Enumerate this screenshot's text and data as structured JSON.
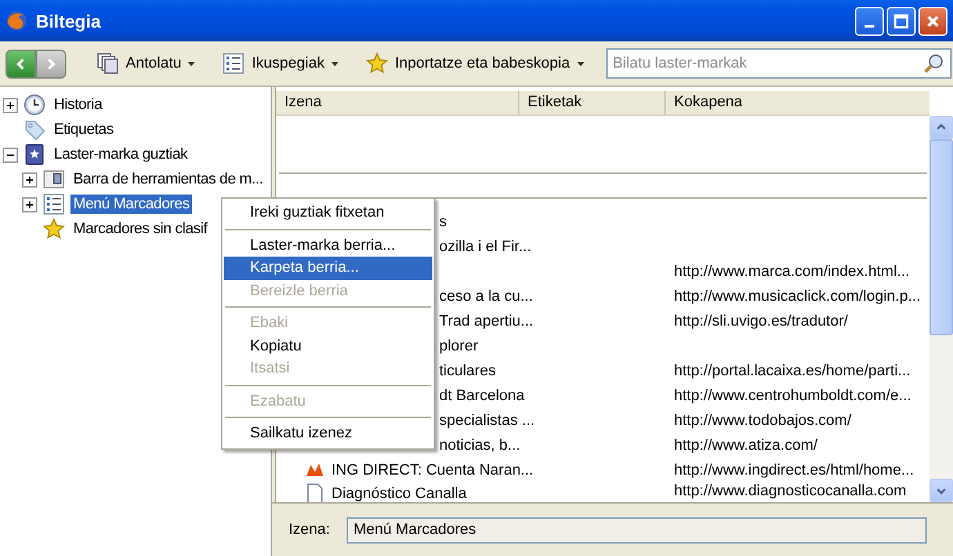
{
  "window": {
    "title": "Biltegia"
  },
  "toolbar": {
    "menus": [
      {
        "label": "Antolatu"
      },
      {
        "label": "Ikuspegiak"
      },
      {
        "label": "Inportatze eta babeskopia"
      }
    ],
    "search": {
      "placeholder": "Bilatu laster-markak"
    }
  },
  "tree": [
    {
      "label": "Historia",
      "kind": "expandable",
      "expanded": false,
      "selected": false
    },
    {
      "label": "Etiquetas",
      "kind": "plain",
      "selected": false
    },
    {
      "label": "Laster-marka guztiak",
      "kind": "expandable",
      "expanded": true,
      "selected": false,
      "children": [
        {
          "label": "Barra de herramientas de m...",
          "kind": "expandable",
          "expanded": false,
          "selected": false
        },
        {
          "label": "Menú Marcadores",
          "kind": "expandable",
          "expanded": false,
          "selected": true
        },
        {
          "label": "Marcadores sin clasif",
          "kind": "plain",
          "selected": false
        }
      ]
    }
  ],
  "table": {
    "columns": [
      "Izena",
      "Etiketak",
      "Kokapena"
    ],
    "rows": [
      {
        "kind": "blank"
      },
      {
        "kind": "blank"
      },
      {
        "kind": "separator"
      },
      {
        "kind": "separator"
      },
      {
        "kind": "bookmark",
        "name": "s",
        "covered": true
      },
      {
        "kind": "bookmark",
        "name": "ozilla i el Fir...",
        "covered": true
      },
      {
        "kind": "bookmark",
        "location": "http://www.marca.com/index.html..."
      },
      {
        "kind": "bookmark",
        "name": "ceso a la cu...",
        "covered": true,
        "location": "http://www.musicaclick.com/login.p..."
      },
      {
        "kind": "bookmark",
        "name": "Trad apertiu...",
        "covered": true,
        "location": "http://sli.uvigo.es/tradutor/"
      },
      {
        "kind": "bookmark",
        "name": "plorer",
        "covered": true
      },
      {
        "kind": "bookmark",
        "name": "ticulares",
        "covered": true,
        "location": "http://portal.lacaixa.es/home/parti..."
      },
      {
        "kind": "bookmark",
        "name": "dt Barcelona",
        "covered": true,
        "location": "http://www.centrohumboldt.com/e..."
      },
      {
        "kind": "bookmark",
        "name": "specialistas ...",
        "covered": true,
        "location": "http://www.todobajos.com/"
      },
      {
        "kind": "bookmark",
        "name": "noticias, b...",
        "covered": true,
        "location": "http://www.atiza.com/"
      },
      {
        "kind": "bookmark",
        "name": "ING DIRECT: Cuenta Naran...",
        "covered": false,
        "location": "http://www.ingdirect.es/html/home..."
      },
      {
        "kind": "bookmark",
        "name": "Diagnóstico Canalla",
        "covered": false,
        "location": "http://www.diagnosticocanalla.com"
      }
    ]
  },
  "details": {
    "label": "Izena:",
    "value": "Menú Marcadores"
  },
  "context_menu": [
    {
      "kind": "item",
      "label": "Ireki guztiak fitxetan",
      "disabled": false,
      "selected": false
    },
    {
      "kind": "separator"
    },
    {
      "kind": "item",
      "label": "Laster-marka berria...",
      "disabled": false,
      "selected": false
    },
    {
      "kind": "item",
      "label": "Karpeta berria...",
      "disabled": false,
      "selected": true
    },
    {
      "kind": "item",
      "label": "Bereizle berria",
      "disabled": true,
      "selected": false
    },
    {
      "kind": "separator"
    },
    {
      "kind": "item",
      "label": "Ebaki",
      "disabled": true,
      "selected": false
    },
    {
      "kind": "item",
      "label": "Kopiatu",
      "disabled": false,
      "selected": false
    },
    {
      "kind": "item",
      "label": "Itsatsi",
      "disabled": true,
      "selected": false
    },
    {
      "kind": "separator"
    },
    {
      "kind": "item",
      "label": "Ezabatu",
      "disabled": true,
      "selected": false
    },
    {
      "kind": "separator"
    },
    {
      "kind": "item",
      "label": "Sailkatu izenez",
      "disabled": false,
      "selected": false
    }
  ]
}
